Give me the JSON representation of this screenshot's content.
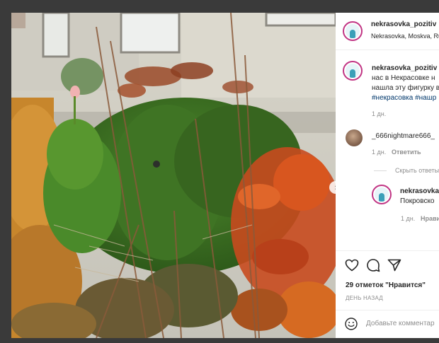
{
  "post": {
    "username": "nekrasovka_pozitiv",
    "location": "Nekrasovka, Moskva, Ru",
    "caption_username": "nekrasovka_pozitiv",
    "caption_line1": "нас в Некрасовке н",
    "caption_line2": "нашла эту фигурку в",
    "caption_tags": "#некрасовка #нашр",
    "caption_time": "1 дн.",
    "likes": "29 отметок \"Нравится\"",
    "date": "ДЕНЬ НАЗАД",
    "add_comment_placeholder": "Добавьте комментар"
  },
  "comments": [
    {
      "username": "_666nightmare666_",
      "time": "1 дн.",
      "reply_label": "Ответить",
      "hide_replies_label": "Скрыть ответы"
    }
  ],
  "reply": {
    "username": "nekrasovka",
    "text": "Покровско",
    "time": "1 дн.",
    "like_label": "Нрави"
  },
  "colors": {
    "accent_link": "#00376b",
    "meta_grey": "#8e8e8e",
    "avatar_ring": "#c13584"
  },
  "icons": [
    "heart-icon",
    "comment-icon",
    "share-icon",
    "emoji-icon",
    "chevron-right-icon"
  ]
}
